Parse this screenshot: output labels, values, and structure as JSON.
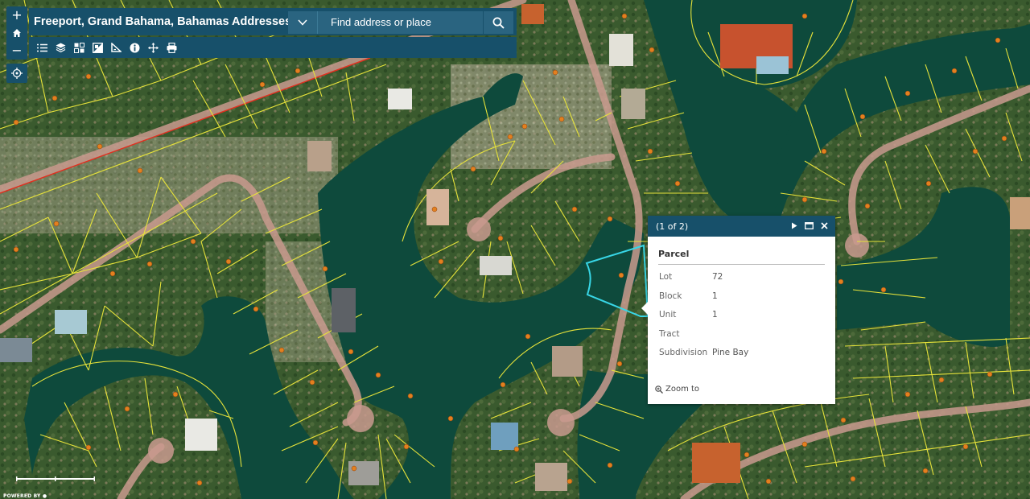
{
  "app": {
    "title": "Freeport, Grand Bahama, Bahamas Addresses"
  },
  "search": {
    "placeholder": "Find address or place"
  },
  "zoom": {
    "in": "+",
    "out": "−"
  },
  "colors": {
    "header": "#17506a",
    "water": "#0e4a3c",
    "parcel_line": "#e6e23a",
    "road": "#c99a8e",
    "marker": "#e3801f",
    "selection": "#38d6e6"
  },
  "toolbar_icons": [
    "list-icon",
    "layers-icon",
    "basemap-icon",
    "swipe-icon",
    "measure-icon",
    "info-icon",
    "pan-icon",
    "print-icon"
  ],
  "popup": {
    "count": "(1 of 2)",
    "title": "Parcel",
    "attributes": [
      {
        "key": "Lot",
        "value": "72"
      },
      {
        "key": "Block",
        "value": "1"
      },
      {
        "key": "Unit",
        "value": "1"
      },
      {
        "key": "Tract",
        "value": ""
      },
      {
        "key": "Subdivision",
        "value": "Pine Bay"
      }
    ],
    "zoom_to": "Zoom to"
  },
  "footer": {
    "powered_by": "POWERED BY"
  }
}
